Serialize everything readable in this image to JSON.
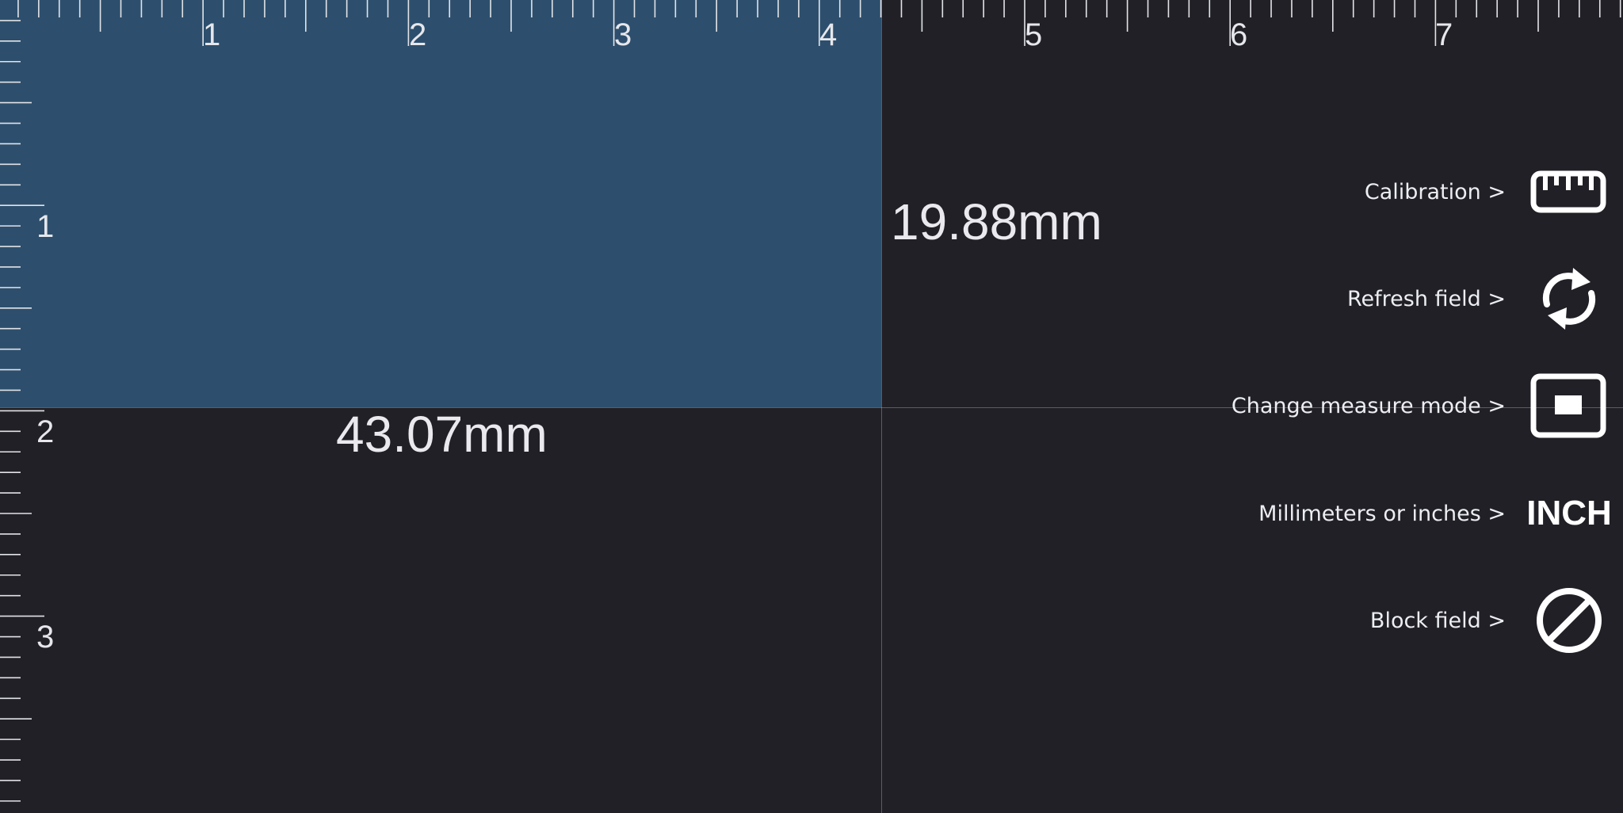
{
  "ruler": {
    "top_numbers": [
      "1",
      "2",
      "3",
      "4",
      "5",
      "6",
      "7"
    ],
    "left_numbers": [
      "1",
      "2",
      "3"
    ]
  },
  "measurement": {
    "height": "19.88mm",
    "width": "43.07mm"
  },
  "menu": [
    {
      "label": "Calibration >",
      "icon": "ruler-icon"
    },
    {
      "label": "Refresh field >",
      "icon": "refresh-icon"
    },
    {
      "label": "Change measure mode >",
      "icon": "measure-mode-icon"
    },
    {
      "label": "Millimeters or inches >",
      "icon": "unit-text",
      "value": "INCH"
    },
    {
      "label": "Block field >",
      "icon": "block-icon"
    }
  ],
  "colors": {
    "background": "#212026",
    "selection": "#2d4f6d",
    "text": "#e9e9ee"
  }
}
